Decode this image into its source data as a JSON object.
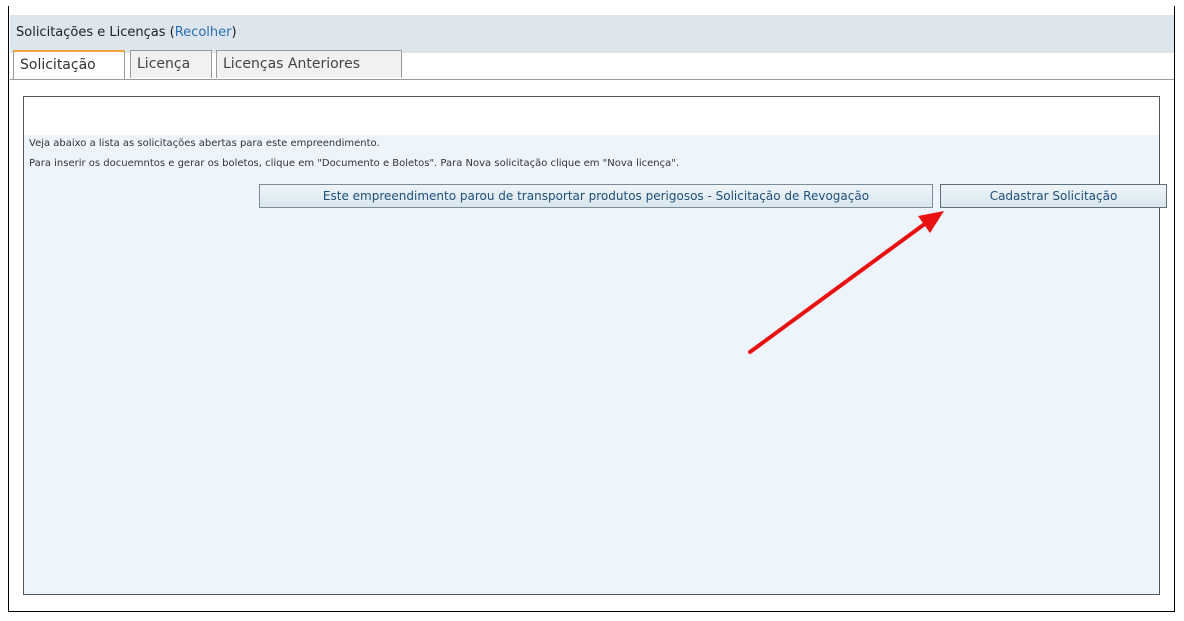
{
  "header": {
    "title": "Solicitações e Licenças",
    "open_paren": "(",
    "collapse_link": "Recolher",
    "close_paren": ")"
  },
  "tabs": [
    {
      "label": "Solicitação",
      "active": true
    },
    {
      "label": "Licença",
      "active": false
    },
    {
      "label": "Licenças Anteriores",
      "active": false
    }
  ],
  "panel": {
    "info_line_1": "Veja abaixo a lista as solicitações abertas para este empreendimento.",
    "info_line_2": "Para inserir os docuemntos e gerar os boletos, clique em \"Documento e Boletos\". Para Nova solicitação clique em \"Nova licença\".",
    "revoke_button": "Este empreendimento parou de transportar produtos perigosos - Solicitação de Revogação",
    "register_button": "Cadastrar Solicitação"
  },
  "annotation": {
    "arrow_color": "#e81010",
    "target": "register_button"
  },
  "colors": {
    "header_bg": "#dde6ec",
    "link": "#2a6fb8",
    "active_tab_accent": "#f0a43a",
    "panel_bg": "#eef4fb"
  }
}
